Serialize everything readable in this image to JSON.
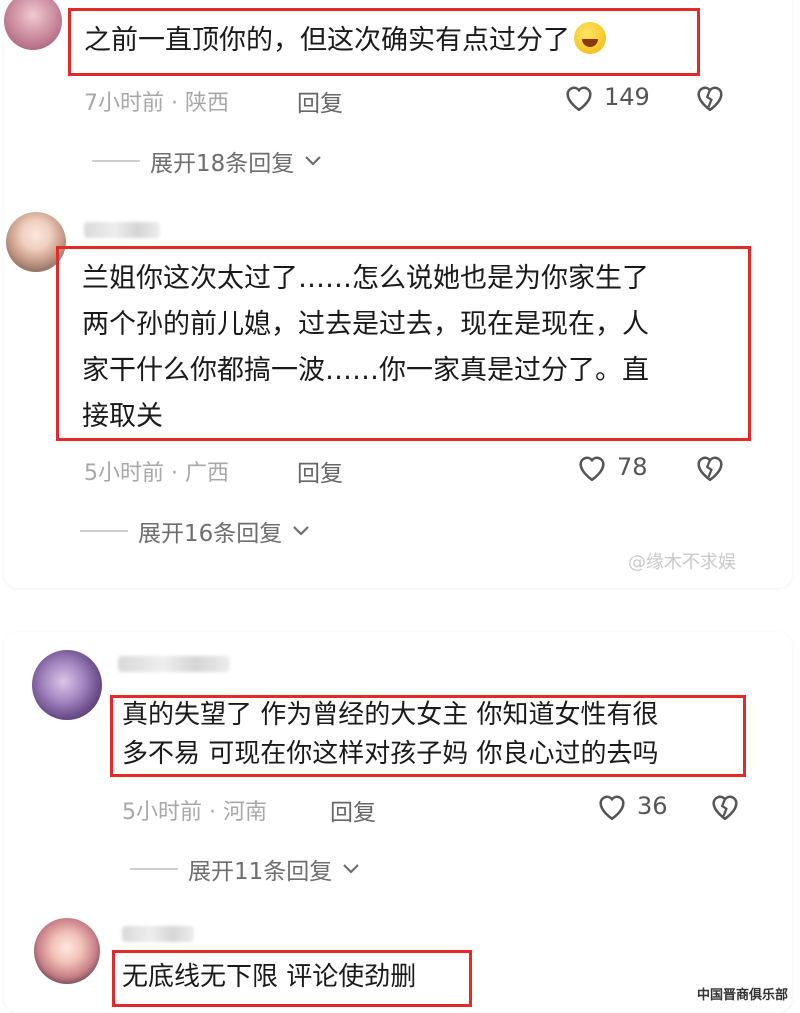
{
  "comments": [
    {
      "text_lines": [
        "之前一直顶你的，但这次确实有点过分了"
      ],
      "time": "7小时前",
      "dot": "·",
      "location": "陕西",
      "reply_label": "回复",
      "likes": "149",
      "expand_label": "展开18条回复"
    },
    {
      "text_lines": [
        "兰姐你这次太过了……怎么说她也是为你家生了",
        "两个孙的前儿媳，过去是过去，现在是现在，人",
        "家干什么你都搞一波……你一家真是过分了。直",
        "接取关"
      ],
      "time": "5小时前",
      "dot": "·",
      "location": "广西",
      "reply_label": "回复",
      "likes": "78",
      "expand_label": "展开16条回复"
    },
    {
      "text_lines": [
        "真的失望了 作为曾经的大女主 你知道女性有很",
        "多不易 可现在你这样对孩子妈  你良心过的去吗"
      ],
      "time": "5小时前",
      "dot": "·",
      "location": "河南",
      "reply_label": "回复",
      "likes": "36",
      "expand_label": "展开11条回复"
    },
    {
      "text_lines": [
        "无底线无下限 评论使劲删"
      ]
    }
  ],
  "watermark": "@缘木不求娱",
  "corner_mark": "中国晋商俱乐部",
  "colors": {
    "highlight_box": "#e32a2a",
    "meta": "#a8a8a8"
  },
  "icons": {
    "like": "heart-outline-icon",
    "dislike": "broken-heart-icon",
    "expand": "chevron-down-icon"
  }
}
